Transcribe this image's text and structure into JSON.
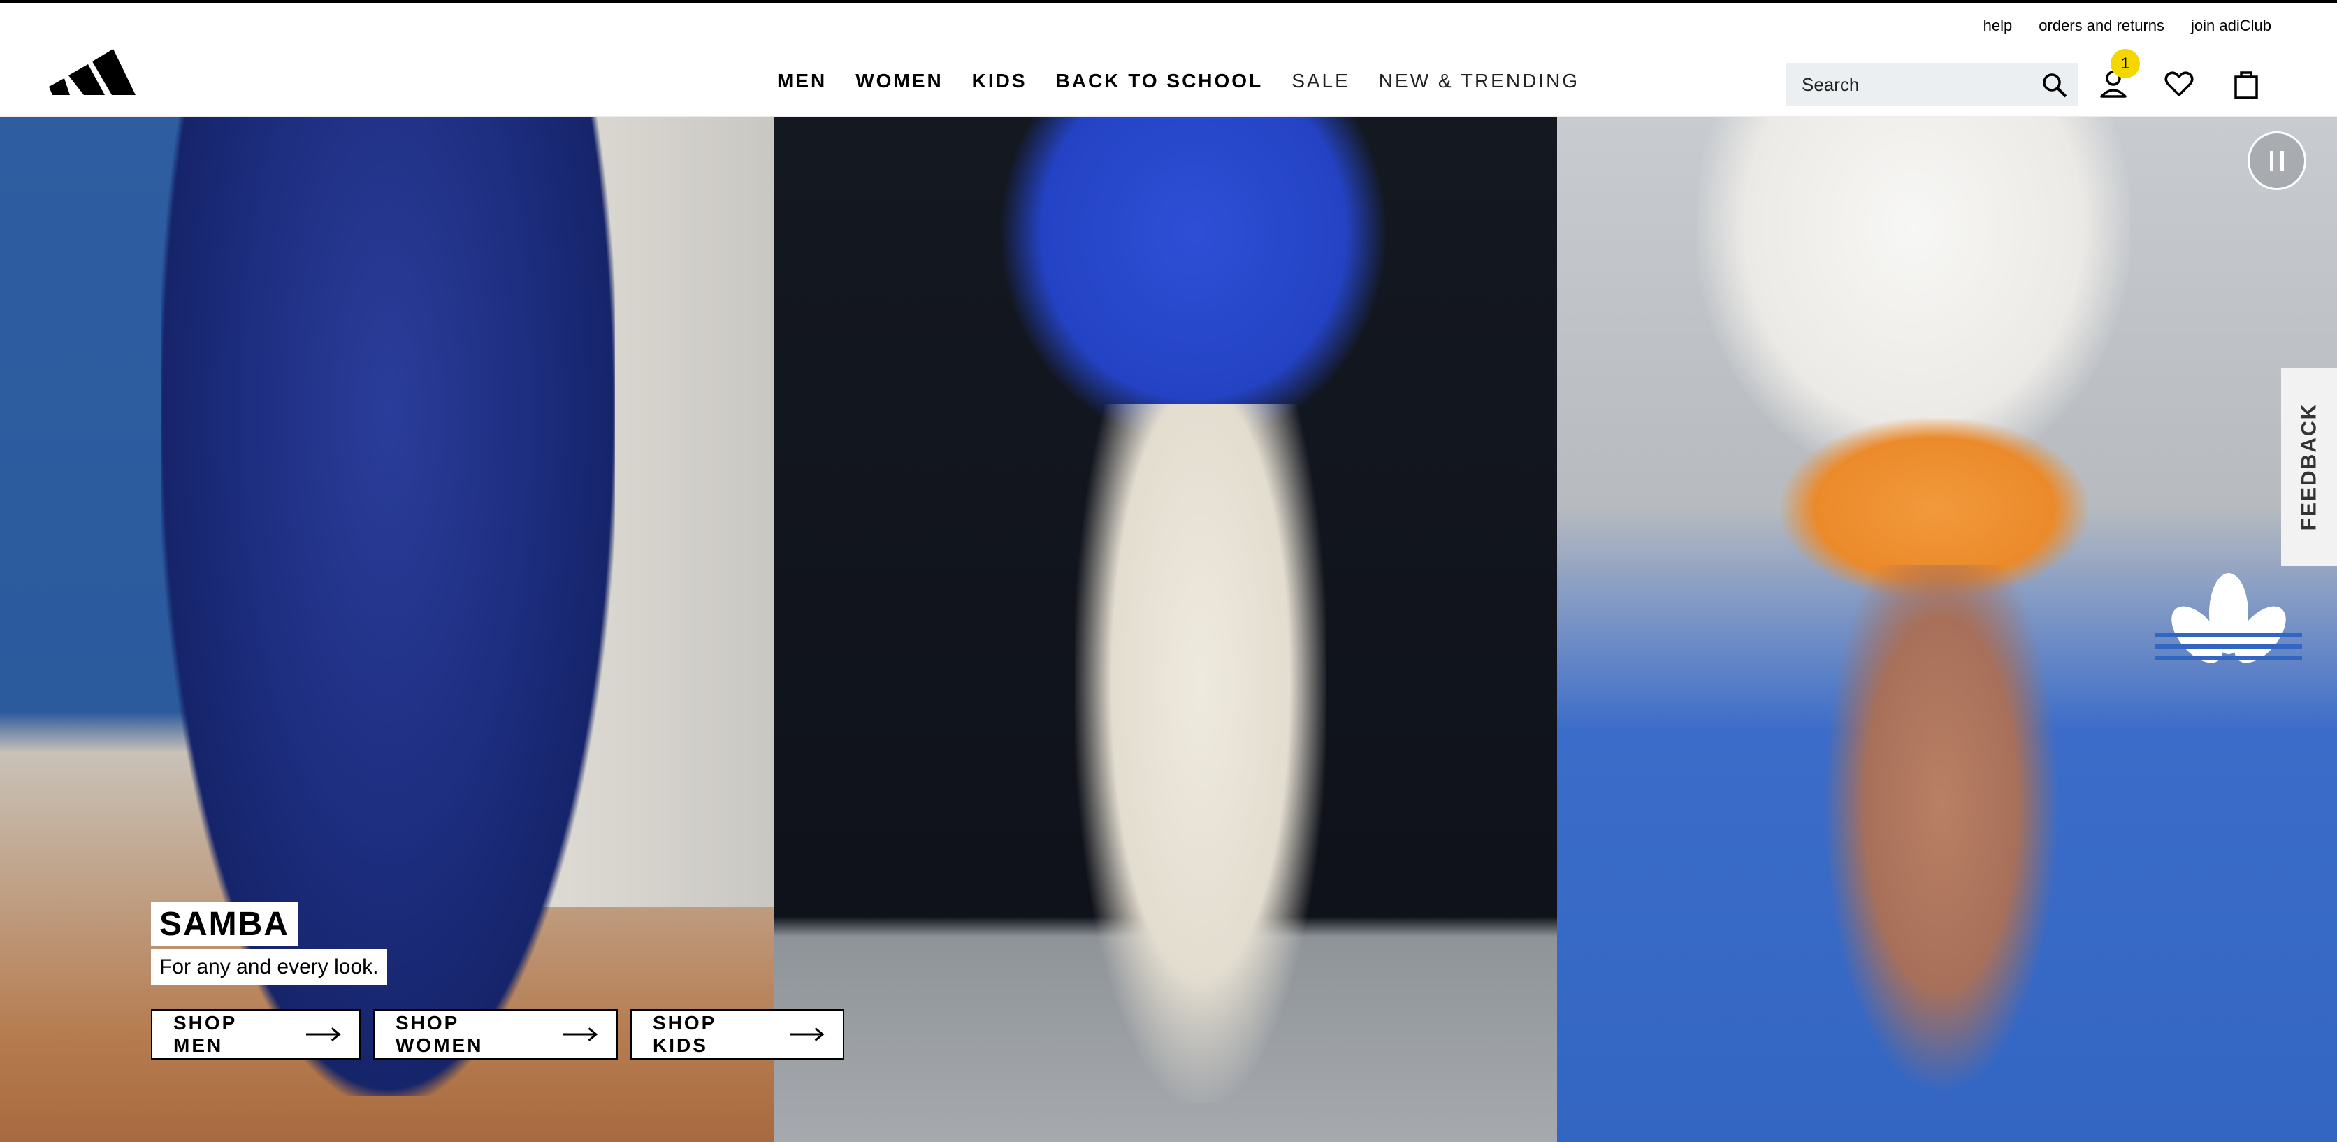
{
  "header": {
    "utility_links": [
      "help",
      "orders and returns",
      "join adiClub"
    ],
    "nav": [
      {
        "label": "MEN",
        "weight": "bold"
      },
      {
        "label": "WOMEN",
        "weight": "bold"
      },
      {
        "label": "KIDS",
        "weight": "bold"
      },
      {
        "label": "BACK TO SCHOOL",
        "weight": "bold"
      },
      {
        "label": "SALE",
        "weight": "light"
      },
      {
        "label": "NEW & TRENDING",
        "weight": "light"
      }
    ],
    "search_placeholder": "Search",
    "account_badge": "1",
    "icons": [
      "adidas-logo",
      "search-icon",
      "account-icon",
      "wishlist-icon",
      "bag-icon"
    ]
  },
  "hero": {
    "title": "SAMBA",
    "subtitle": "For any and every look.",
    "ctas": [
      "SHOP MEN",
      "SHOP WOMEN",
      "SHOP KIDS"
    ],
    "icons": [
      "pause-icon",
      "trefoil-logo"
    ]
  },
  "feedback_tab": "FEEDBACK",
  "colors": {
    "accent_badge": "#f5d700",
    "text": "#000000",
    "search_bg": "#eceff1"
  }
}
